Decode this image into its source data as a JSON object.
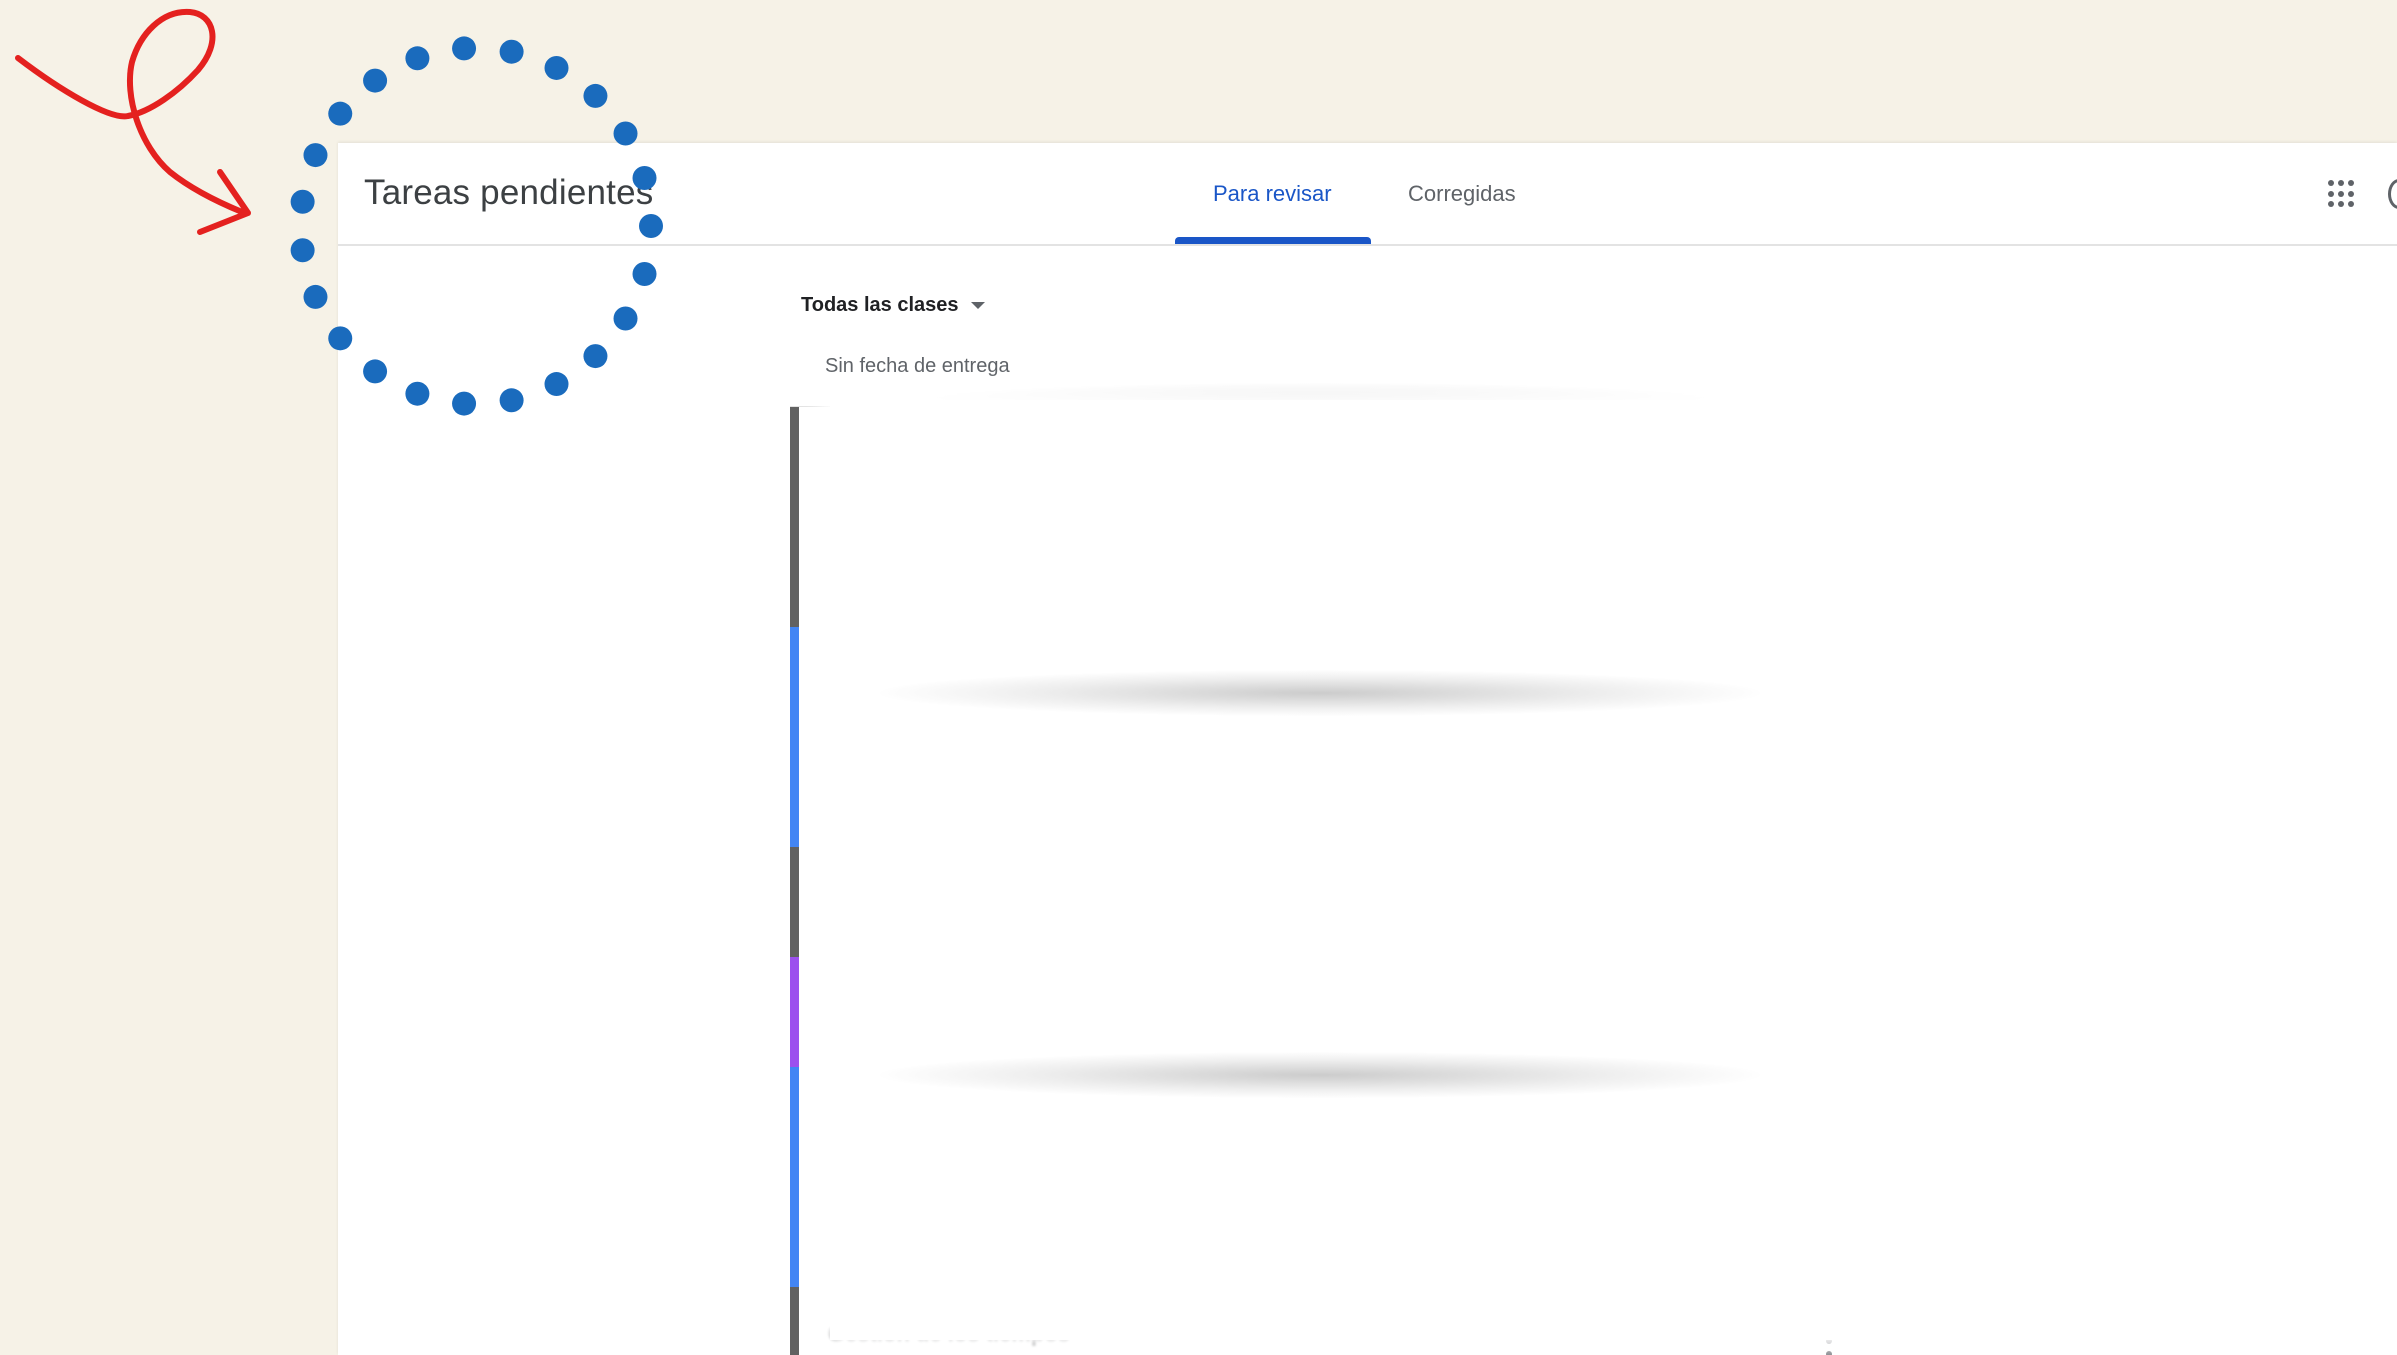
{
  "app": {
    "title": "Tareas pendientes"
  },
  "tabs": [
    {
      "label": "Para revisar",
      "active": true
    },
    {
      "label": "Corregidas",
      "active": false
    }
  ],
  "toolbar": {
    "apps_icon": "apps-grid-icon",
    "account_icon": "account-icon"
  },
  "filter": {
    "class_select_value": "Todas las clases"
  },
  "section": {
    "label": "Sin fecha de entrega"
  },
  "list": {
    "rows": [
      {
        "title": "",
        "accent": "#616161"
      },
      {
        "title": "",
        "accent": "#616161"
      },
      {
        "title": "",
        "accent": "#4285f4"
      },
      {
        "title": "",
        "accent": "#4285f4"
      },
      {
        "title": "",
        "accent": "#616161"
      },
      {
        "title": "",
        "accent": "#9c50ee"
      },
      {
        "title": "",
        "accent": "#4285f4"
      },
      {
        "title": "",
        "accent": "#4285f4"
      },
      {
        "title": "Gestión de los tiempos",
        "accent": "#616161"
      }
    ],
    "more_icon": "more-vert-icon"
  },
  "annotation": {
    "circle_color": "#1a6bbd",
    "arrow_color": "#e4211f"
  },
  "colors": {
    "background": "#f6f2e7",
    "accent_blue": "#1a56c7"
  }
}
